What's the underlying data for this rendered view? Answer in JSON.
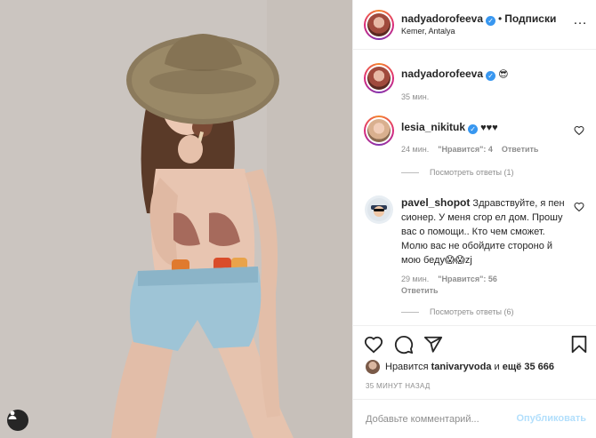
{
  "post": {
    "author": "nadyadorofeeva",
    "follow_label": "Подписки",
    "location": "Kemer, Antalya"
  },
  "caption": {
    "username": "nadyadorofeeva",
    "text": "😎",
    "time": "35 мин."
  },
  "comments": [
    {
      "username": "lesia_nikituk",
      "text": "♥♥♥",
      "time": "24 мин.",
      "likes": "\"Нравится\": 4",
      "reply_label": "Ответить",
      "view_replies": "Посмотреть ответы (1)"
    },
    {
      "username": "pavel_shopot",
      "text": "Здравствуйте, я пен сионер. У меня сгор ел дом. Прошу вас о помощи.. Кто чем сможет. Молю вас не обойдите стороно й мою беду😱😱zj",
      "time": "29 мин.",
      "likes": "\"Нравится\": 56",
      "reply_label": "Ответить",
      "view_replies": "Посмотреть ответы (6)"
    }
  ],
  "likes_line": {
    "prefix": "Нравится",
    "user": "tanivaryvoda",
    "middle": "и",
    "rest": "ещё 35 666"
  },
  "timestamp": "35 МИНУТ НАЗАД",
  "add_comment": {
    "placeholder": "Добавьте комментарий...",
    "publish_label": "Опубликовать"
  },
  "icons": {
    "verified": "verified-badge-icon",
    "like": "heart-icon",
    "comment": "comment-bubble-icon",
    "share": "paper-plane-icon",
    "save": "bookmark-icon",
    "more": "more-options-icon",
    "emoji": "emoji-icon",
    "user_tag": "user-tag-icon"
  },
  "colors": {
    "link_blue": "#3897f0",
    "publish_disabled": "#b2dffc",
    "text": "#262626",
    "muted": "#8e8e8e"
  }
}
